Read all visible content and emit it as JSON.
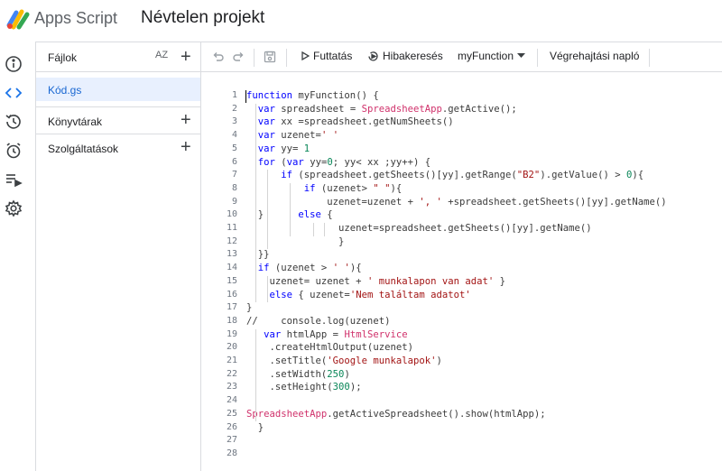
{
  "header": {
    "app_name": "Apps Script",
    "project_name": "Névtelen projekt"
  },
  "rail": {
    "items": [
      "info-icon",
      "code-icon",
      "history-icon",
      "alarm-icon",
      "executions-icon",
      "settings-icon"
    ]
  },
  "files_panel": {
    "title": "Fájlok",
    "sort_icon": "AZ",
    "files": [
      "Kód.gs"
    ],
    "sections": [
      "Könyvtárak",
      "Szolgáltatások"
    ]
  },
  "toolbar": {
    "run_label": "Futtatás",
    "debug_label": "Hibakeresés",
    "function_label": "myFunction",
    "log_label": "Végrehajtási napló"
  },
  "code": {
    "line_numbers": [
      "1",
      "2",
      "3",
      "4",
      "5",
      "6",
      "7",
      "8",
      "9",
      "10",
      "11",
      "12",
      "13",
      "14",
      "15",
      "16",
      "17",
      "18",
      "19",
      "20",
      "21",
      "22",
      "23",
      "24",
      "25",
      "26",
      "27",
      "28"
    ],
    "lines": [
      "function myFunction() {",
      "  var spreadsheet = SpreadsheetApp.getActive();",
      "  var xx =spreadsheet.getNumSheets()",
      "  var uzenet=' '",
      "  var yy= 1",
      "  for (var yy=0; yy< xx ;yy++) {",
      "      if (spreadsheet.getSheets()[yy].getRange(\"B2\").getValue() > 0){",
      "          if (uzenet> \" \"){",
      "              uzenet=uzenet + ', ' +spreadsheet.getSheets()[yy].getName()",
      "  }      else {",
      "                uzenet=spreadsheet.getSheets()[yy].getName()",
      "                }",
      "  }}",
      "  if (uzenet > ' '){",
      "    uzenet= uzenet + ' munkalapon van adat' }",
      "    else { uzenet='Nem találtam adatot'",
      "}",
      "//    console.log(uzenet)",
      "   var htmlApp = HtmlService",
      "    .createHtmlOutput(uzenet)",
      "    .setTitle('Google munkalapok')",
      "    .setWidth(250)",
      "    .setHeight(300);",
      "",
      "SpreadsheetApp.getActiveSpreadsheet().show(htmlApp);",
      "  }",
      "",
      ""
    ]
  }
}
